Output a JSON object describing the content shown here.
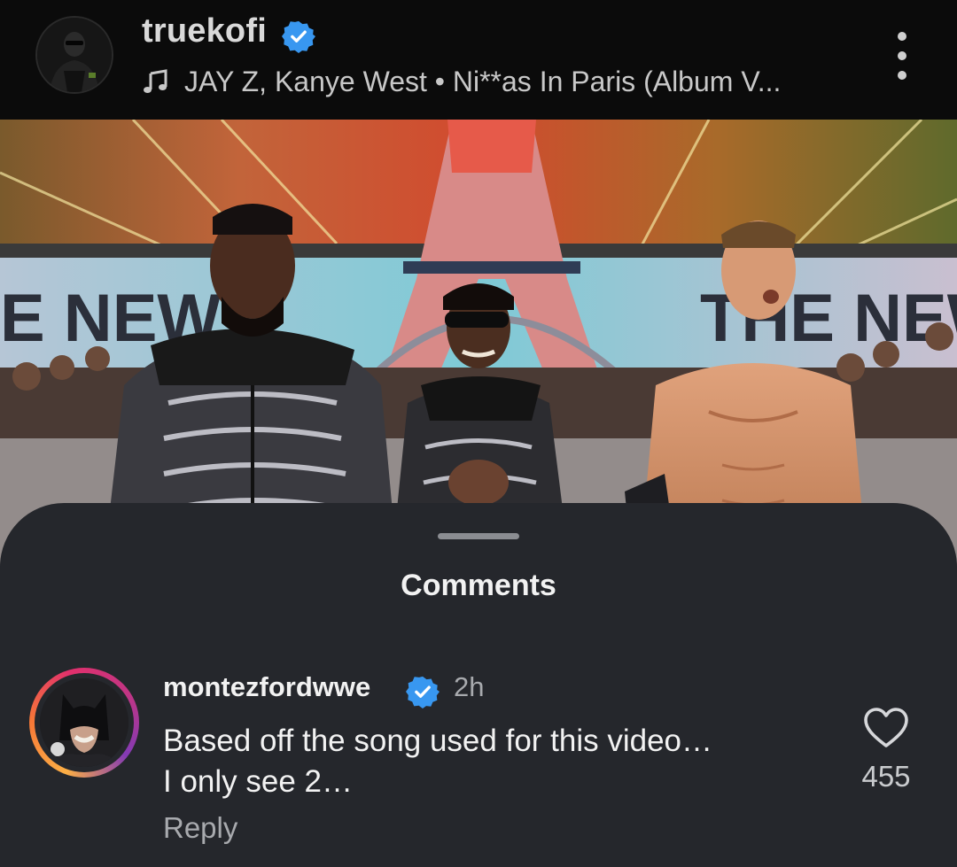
{
  "post": {
    "username": "truekofi",
    "verified": true,
    "music": "JAY Z, Kanye West • Ni**as In Paris (Album V...",
    "icons": {
      "verified": "verified-badge-icon",
      "music": "music-note-icon",
      "more": "more-vertical-icon"
    }
  },
  "video": {
    "description": "Three wrestlers walking down an entrance ramp with an Eiffel Tower stage set and crowd behind them",
    "banner_text_left": "E NEW",
    "banner_text_right": "THE NEW"
  },
  "comments_sheet": {
    "title": "Comments",
    "comments": [
      {
        "username": "montezfordwwe",
        "verified": true,
        "time": "2h",
        "text_line1": "Based off the song used for this video…",
        "text_line2": "I only see 2…",
        "reply_label": "Reply",
        "likes": "455",
        "icons": {
          "like": "heart-outline-icon",
          "avatar": "profile-avatar"
        }
      }
    ]
  },
  "colors": {
    "header_bg": "#0b0b0b",
    "sheet_bg": "#25272c",
    "verified_blue": "#3897f0",
    "secondary_text": "#a8aaae"
  }
}
